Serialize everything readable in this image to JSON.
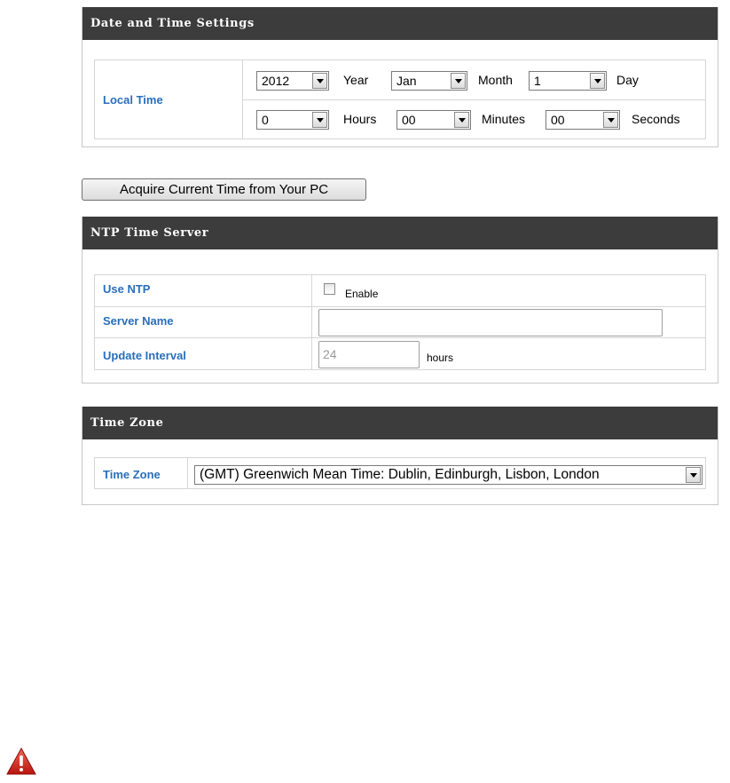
{
  "date_time": {
    "header": "Date and Time Settings",
    "local_time_label": "Local Time",
    "year": "2012",
    "year_unit": "Year",
    "month": "Jan",
    "month_unit": "Month",
    "day": "1",
    "day_unit": "Day",
    "hours": "0",
    "hours_unit": "Hours",
    "minutes": "00",
    "minutes_unit": "Minutes",
    "seconds": "00",
    "seconds_unit": "Seconds"
  },
  "acquire_button": "Acquire Current Time from Your PC",
  "ntp": {
    "header": "NTP Time Server",
    "use_ntp_label": "Use NTP",
    "enable_label": "Enable",
    "enable_checked": false,
    "server_name_label": "Server Name",
    "server_name_value": "",
    "update_interval_label": "Update Interval",
    "update_interval_value": "24",
    "update_interval_unit": "hours"
  },
  "timezone": {
    "header": "Time Zone",
    "label": "Time Zone",
    "value": "(GMT) Greenwich Mean Time: Dublin, Edinburgh, Lisbon, London"
  },
  "colors": {
    "header_bg": "#3c3c3c",
    "label_blue": "#2a6ebb",
    "warning_red": "#d9261c"
  },
  "icons": {
    "warning": "warning-triangle-icon",
    "dropdown": "chevron-down-icon"
  }
}
